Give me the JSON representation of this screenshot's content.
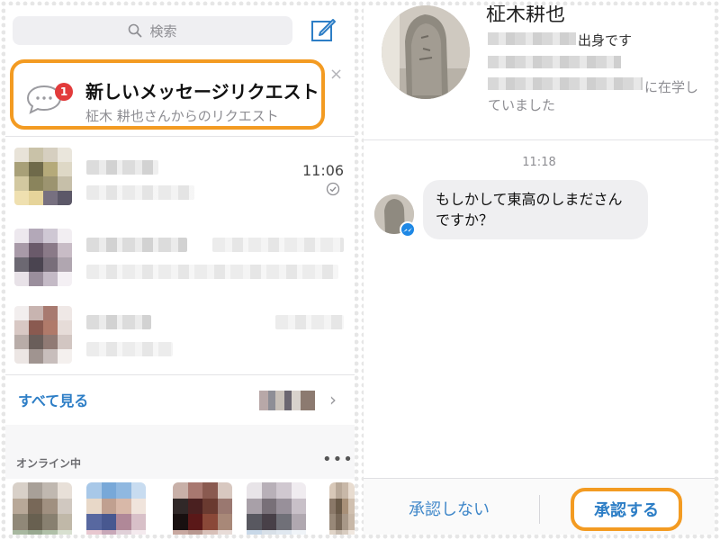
{
  "left": {
    "search": {
      "placeholder": "検索",
      "icon": "search-icon"
    },
    "compose_icon": "compose-icon",
    "request_banner": {
      "badge_count": "1",
      "title": "新しいメッセージリクエスト",
      "subtitle": "柾木 耕也さんからのリクエスト",
      "close": "×",
      "highlight_color": "#f39b22"
    },
    "conversations": [
      {
        "time": "11:06",
        "status": "read-check-icon"
      }
    ],
    "see_all": {
      "label": "すべて見る",
      "chevron": "›"
    },
    "online": {
      "label": "オンライン中",
      "more": "•••"
    }
  },
  "right": {
    "profile": {
      "name": "柾木耕也",
      "line1_suffix": "出身です",
      "line3_suffix": "に在学し",
      "line4": "ていました"
    },
    "chat": {
      "time": "11:18",
      "message": "もしかして東高のしまださんですか？"
    },
    "actions": {
      "decline": "承認しない",
      "accept": "承認する",
      "accent": "#2d7ec6"
    }
  }
}
